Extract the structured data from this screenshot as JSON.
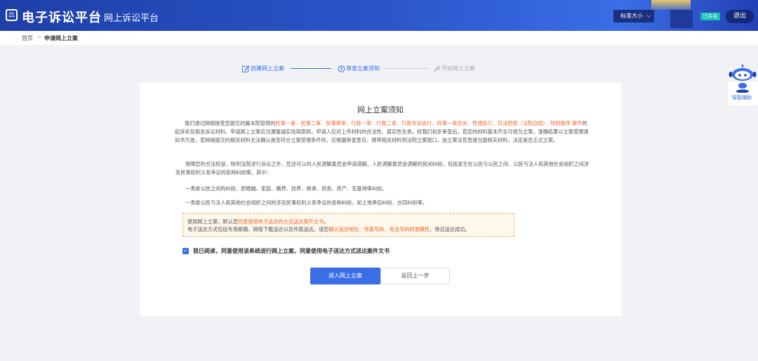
{
  "header": {
    "logo_glyph": "⚖",
    "title": "电子诉讼平台",
    "subtitle": "网上诉讼平台",
    "size_select": "标准大小",
    "verified_badge": "已实名",
    "logout": "退出"
  },
  "breadcrumb": {
    "home": "首页",
    "separator": ">",
    "current": "申请网上立案"
  },
  "steps": [
    {
      "label": "创建网上立案",
      "state": "done",
      "icon": "edit-icon"
    },
    {
      "label": "审查立案须知",
      "state": "active",
      "icon": "question-icon"
    },
    {
      "label": "开始网上立案",
      "state": "pending",
      "icon": "wand-icon"
    }
  ],
  "card": {
    "title": "网上立案须知",
    "p1": {
      "a": "我们通过网络接受您提交的属本院管辖的",
      "b": "民事一审、民事二审、民事再审、行政一审、行政二审、行政非诉执行、刑事一审自诉、普通执行、司法赔偿（法院自赔）、特别程序 案件",
      "c": "的起诉状及相关诉讼材料。申请网上立案应当遵循诚实信用原则，申请人应对上传材料的合法性、真实性负责。经我们初步审查后，若您的材料基本齐全可视为立案，准确结果以立案受理通知书为准。若网络提交的相关材料无法确认是否符合立案受理条件的，应根据审查意见，携带相关材料到法院立案窗口，由立案法官直接当面核实材料，决定是否正式立案。"
    },
    "p2": "保障您的合法权益，除到法院进行诉讼之外，您还可以向人民调解委员会申请调解。人民调解委员会调解的民间纠纷，包括发生在公民与公民之间、公民与法人和其他社会组织之间涉及民事权利义务争议的各种纠纷案。其中：",
    "p3": "一类是公民之间的纠纷，即婚姻、家庭、赡养、抚养、继承、债务、房产、宅基地等纠纷。",
    "p4": "一类是公民与法人和其他社会组织之间的涉及民事权利义务争议的各种纠纷，如土地承包纠纷、合同纠纷等。",
    "notice": {
      "line1_a": "使用网上立案，默认您",
      "line1_b": "同意使用电子送达的方式送达案件文书",
      "line1_c": "。",
      "line2_a": "电子送达方式包括专用邮箱、网络下载送达以及传真送达。请您",
      "line2_b": "确认送达地址、传真号码、电话号码的准确性",
      "line2_c": "，保证送达成功。"
    },
    "agree_label": "我已阅读，同意使用该系统进行网上立案，同意使用电子送达方式送达案件文书",
    "primary_button": "进入网上立案",
    "secondary_button": "返回上一步"
  },
  "assistant": {
    "label": "智能辅助"
  },
  "colors": {
    "header_blue": "#2a55c9",
    "accent": "#3a6ee6",
    "highlight_orange": "#ea6a2a",
    "verified_teal": "#16c0b0"
  }
}
